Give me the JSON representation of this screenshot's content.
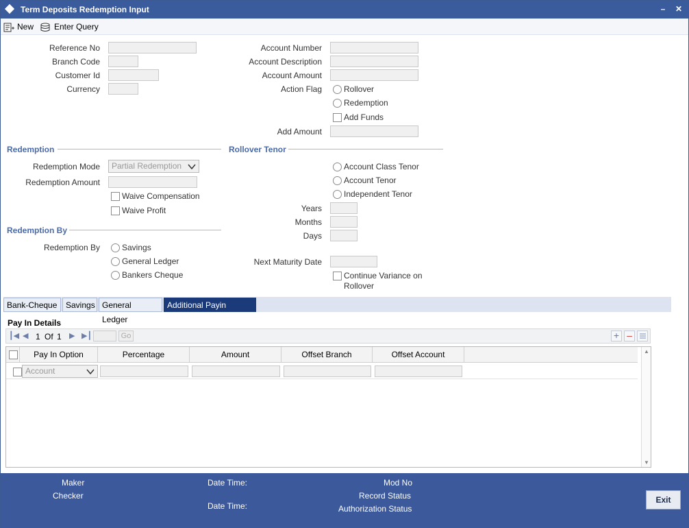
{
  "window": {
    "title": "Term Deposits Redemption Input",
    "minimize_label": "–",
    "close_label": "✕"
  },
  "toolbar": {
    "new_label": "New",
    "enter_query_label": "Enter Query"
  },
  "main": {
    "reference_no_label": "Reference No",
    "branch_code_label": "Branch Code",
    "customer_id_label": "Customer Id",
    "currency_label": "Currency",
    "account_number_label": "Account Number",
    "account_description_label": "Account Description",
    "account_amount_label": "Account Amount",
    "action_flag_label": "Action Flag",
    "action_flag_options": [
      "Rollover",
      "Redemption"
    ],
    "add_funds_label": "Add Funds",
    "add_amount_label": "Add Amount"
  },
  "redemption": {
    "section_title": "Redemption",
    "mode_label": "Redemption Mode",
    "mode_value": "Partial Redemption",
    "amount_label": "Redemption Amount",
    "waive_compensation_label": "Waive Compensation",
    "waive_profit_label": "Waive Profit"
  },
  "rollover_tenor": {
    "section_title": "Rollover Tenor",
    "options": [
      "Account Class Tenor",
      "Account Tenor",
      "Independent Tenor"
    ],
    "years_label": "Years",
    "months_label": "Months",
    "days_label": "Days",
    "next_maturity_label": "Next Maturity Date",
    "continue_variance_line1": "Continue Variance on",
    "continue_variance_line2": "Rollover"
  },
  "redemption_by": {
    "section_title": "Redemption By",
    "label": "Redemption By",
    "options": [
      "Savings",
      "General Ledger",
      "Bankers Cheque"
    ]
  },
  "tabs": [
    "Bank-Cheque",
    "Savings",
    "General Ledger",
    "Additional Payin Details"
  ],
  "payin": {
    "title": "Pay In Details",
    "pagination": {
      "current": "1",
      "of_label": "Of",
      "total": "1",
      "go_label": "Go"
    },
    "columns": [
      "Pay In Option",
      "Percentage",
      "Amount",
      "Offset Branch",
      "Offset Account"
    ],
    "row_option_value": "Account"
  },
  "footer": {
    "maker_label": "Maker",
    "checker_label": "Checker",
    "date_time_label": "Date Time:",
    "mod_no_label": "Mod No",
    "record_status_label": "Record Status",
    "authorization_status_label": "Authorization Status",
    "exit_label": "Exit"
  },
  "colors": {
    "titlebar": "#3a5b9c",
    "active_tab": "#1b3a7a",
    "section_title": "#4a6aa8",
    "footer": "#3c5a9b"
  }
}
